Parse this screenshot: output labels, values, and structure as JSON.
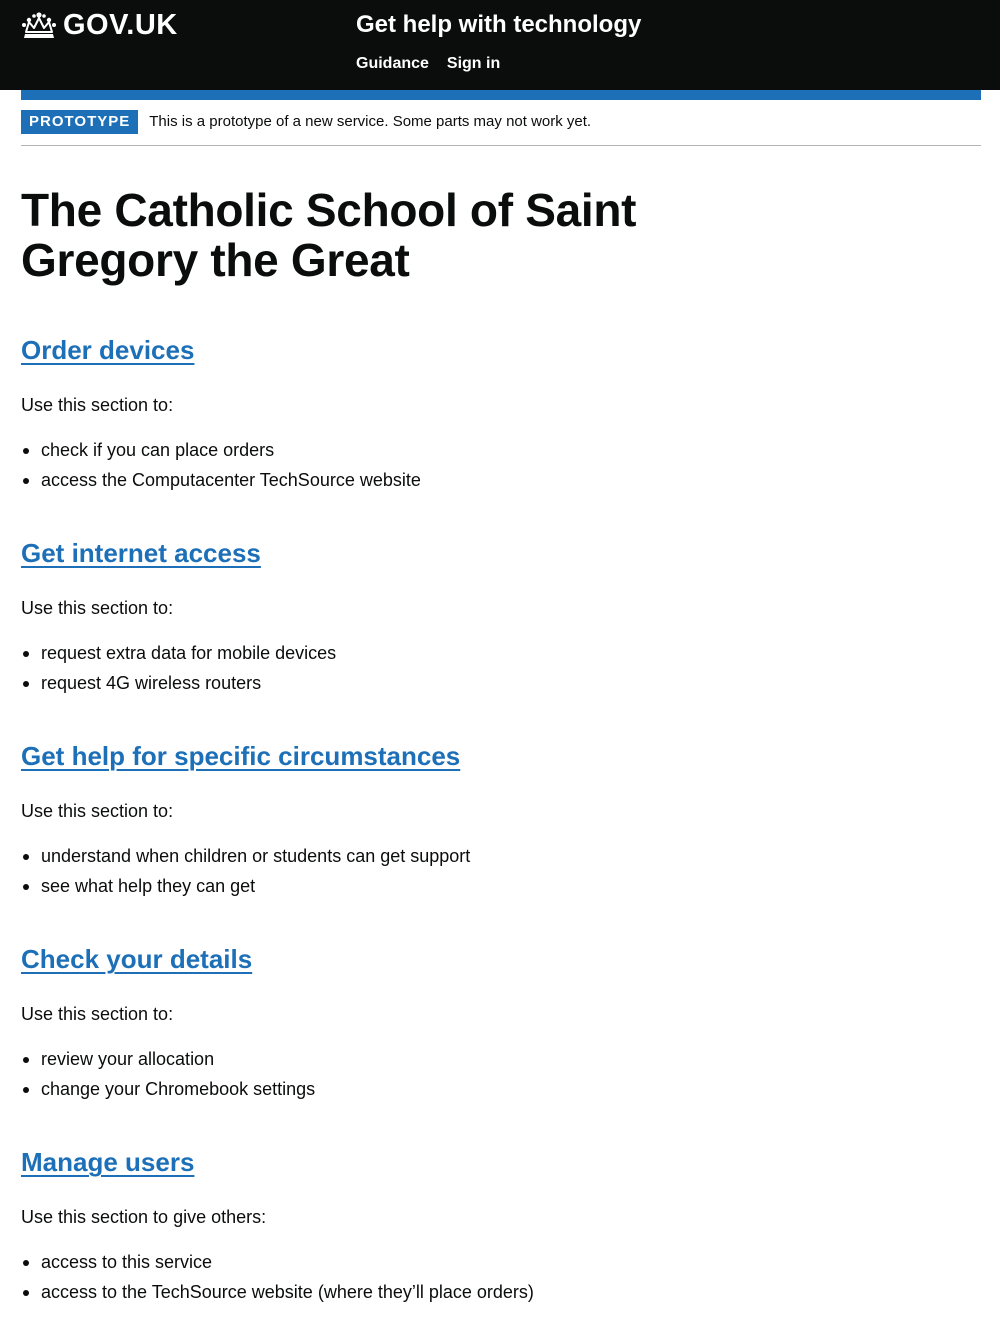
{
  "header": {
    "logo_text": "GOV.UK",
    "logo_icon": "crown-icon",
    "service_name": "Get help with technology",
    "nav": [
      {
        "label": "Guidance"
      },
      {
        "label": "Sign in"
      }
    ]
  },
  "phase_banner": {
    "tag": "PROTOTYPE",
    "text": "This is a prototype of a new service. Some parts may not work yet."
  },
  "page": {
    "title": "The Catholic School of Saint Gregory the Great",
    "sections": [
      {
        "heading": "Order devices",
        "intro": "Use this section to:",
        "items": [
          "check if you can place orders",
          "access the Computacenter TechSource website"
        ]
      },
      {
        "heading": "Get internet access",
        "intro": "Use this section to:",
        "items": [
          "request extra data for mobile devices",
          "request 4G wireless routers"
        ]
      },
      {
        "heading": "Get help for specific circumstances",
        "intro": "Use this section to:",
        "items": [
          "understand when children or students can get support",
          "see what help they can get"
        ]
      },
      {
        "heading": "Check your details",
        "intro": "Use this section to:",
        "items": [
          "review your allocation",
          "change your Chromebook settings"
        ]
      },
      {
        "heading": "Manage users",
        "intro": "Use this section to give others:",
        "items": [
          "access to this service",
          "access to the TechSource website (where they’ll place orders)"
        ]
      }
    ]
  },
  "colors": {
    "header_bg": "#0b0c0c",
    "link": "#1d70b8",
    "phase_tag_bg": "#1d70b8",
    "text": "#0b0c0c"
  }
}
